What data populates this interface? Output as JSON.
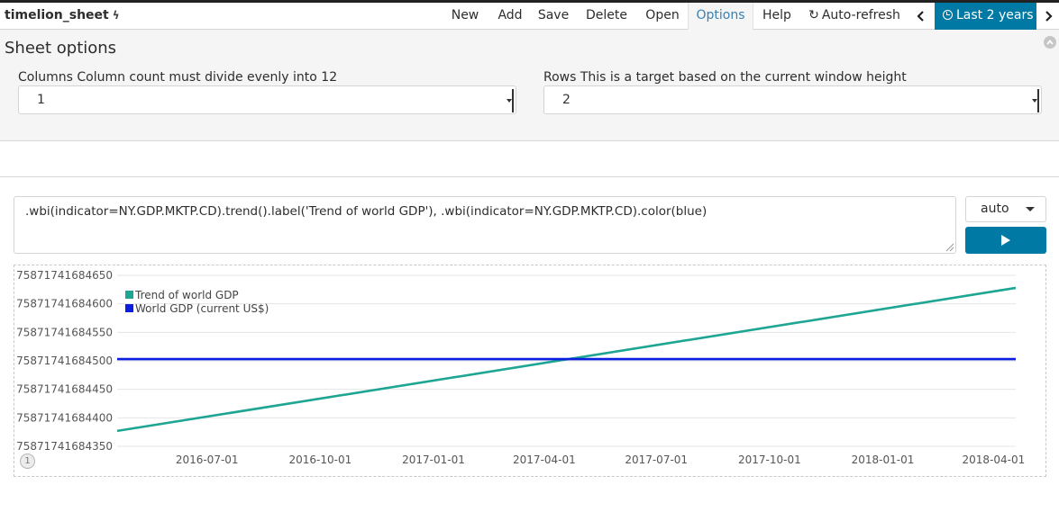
{
  "app": {
    "title": "timelion_sheet"
  },
  "nav": {
    "items": [
      "New",
      "Add",
      "Save",
      "Delete",
      "Open",
      "Options",
      "Help",
      "Auto-refresh"
    ],
    "active": "Options",
    "time_range": "Last 2 years"
  },
  "options": {
    "title": "Sheet options",
    "columns_label": "Columns Column count must divide evenly into 12",
    "columns_value": "1",
    "rows_label": "Rows This is a target based on the current window height",
    "rows_value": "2"
  },
  "expression": {
    "text": ".wbi(indicator=NY.GDP.MKTP.CD).trend().label('Trend of world GDP'),  .wbi(indicator=NY.GDP.MKTP.CD).color(blue)",
    "interval": "auto"
  },
  "panel": {
    "number": "1"
  },
  "colors": {
    "accent": "#0079a5",
    "trend": "#1ea593",
    "gdp": "#0a1de0"
  },
  "chart_data": {
    "type": "line",
    "y_ticks": [
      "75871741684650",
      "75871741684600",
      "75871741684550",
      "75871741684500",
      "75871741684450",
      "75871741684400",
      "75871741684350"
    ],
    "x_ticks": [
      "2016-07-01",
      "2016-10-01",
      "2017-01-01",
      "2017-04-01",
      "2017-07-01",
      "2017-10-01",
      "2018-01-01",
      "2018-04-01"
    ],
    "ylim": [
      75871741684350,
      75871741684650
    ],
    "xlim": [
      "2016-04-19",
      "2018-04-19"
    ],
    "series": [
      {
        "name": "Trend of world GDP",
        "color": "#1ea593",
        "x": [
          "2016-04-19",
          "2018-04-19"
        ],
        "y": [
          75871741684377,
          75871741684628
        ]
      },
      {
        "name": "World GDP (current US$)",
        "color": "#0a1de0",
        "x": [
          "2016-04-19",
          "2018-04-19"
        ],
        "y": [
          75871741684503,
          75871741684503
        ]
      }
    ],
    "legend": "top-left",
    "grid": true
  }
}
